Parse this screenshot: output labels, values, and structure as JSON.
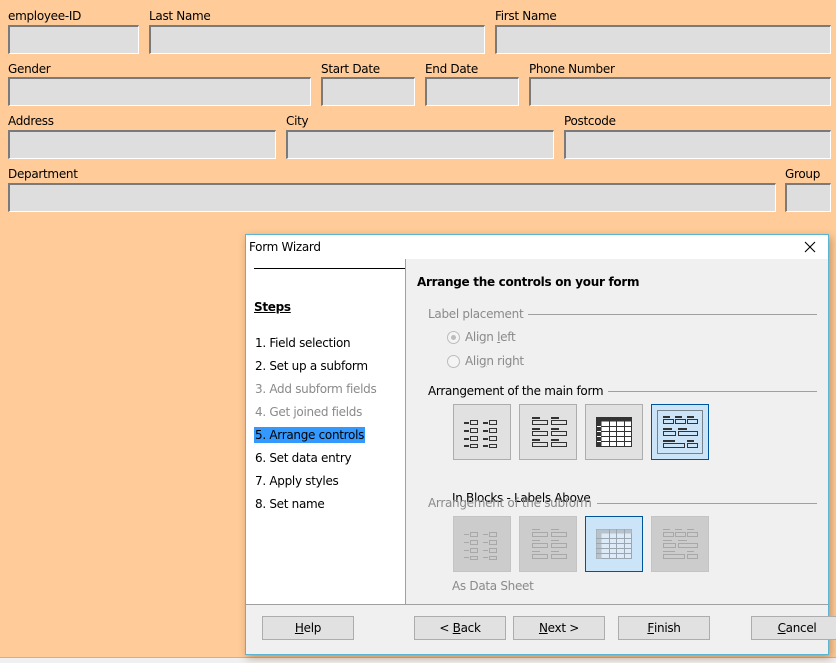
{
  "form": {
    "fields": [
      {
        "label": "employee-ID"
      },
      {
        "label": "Last Name"
      },
      {
        "label": "First Name"
      },
      {
        "label": "Gender"
      },
      {
        "label": "Start Date"
      },
      {
        "label": "End Date"
      },
      {
        "label": "Phone Number"
      },
      {
        "label": "Address"
      },
      {
        "label": "City"
      },
      {
        "label": "Postcode"
      },
      {
        "label": "Department"
      },
      {
        "label": "Group"
      }
    ]
  },
  "dialog": {
    "title": "Form Wizard",
    "close_icon": "close-icon",
    "steps_title": "Steps",
    "steps": [
      {
        "label": "1. Field selection",
        "state": "enabled"
      },
      {
        "label": "2. Set up a subform",
        "state": "enabled"
      },
      {
        "label": "3. Add subform fields",
        "state": "disabled"
      },
      {
        "label": "4. Get joined fields",
        "state": "disabled"
      },
      {
        "label": "5. Arrange controls",
        "state": "active"
      },
      {
        "label": "6. Set data entry",
        "state": "enabled"
      },
      {
        "label": "7. Apply styles",
        "state": "enabled"
      },
      {
        "label": "8. Set name",
        "state": "enabled"
      }
    ],
    "heading": "Arrange the controls on your form",
    "label_placement": {
      "title": "Label placement",
      "options": [
        {
          "pre": "Align ",
          "mnemonic": "l",
          "post": "eft",
          "checked": true
        },
        {
          "pre": "Ali",
          "mnemonic": "g",
          "post": "n right",
          "checked": false
        }
      ]
    },
    "main_form": {
      "title": "Arrangement of the main form",
      "layouts": [
        "Columnar - Labels Left",
        "Columnar - Labels on Top",
        "As Data Sheet",
        "In Blocks - Labels Above"
      ],
      "selected_index": 3,
      "selected_caption": "In Blocks - Labels Above"
    },
    "subform": {
      "title": "Arrangement of the subform",
      "layouts": [
        "Columnar - Labels Left",
        "Columnar - Labels on Top",
        "As Data Sheet",
        "In Blocks - Labels Above"
      ],
      "selected_index": 2,
      "selected_caption": "As Data Sheet"
    },
    "buttons": {
      "help": {
        "mnemonic": "H",
        "rest": "elp"
      },
      "back": {
        "pre": "< ",
        "mnemonic": "B",
        "rest": "ack"
      },
      "next": {
        "mnemonic": "N",
        "rest": "ext >"
      },
      "finish": {
        "mnemonic": "F",
        "rest": "inish"
      },
      "cancel": {
        "mnemonic": "C",
        "rest": "ancel"
      }
    }
  }
}
